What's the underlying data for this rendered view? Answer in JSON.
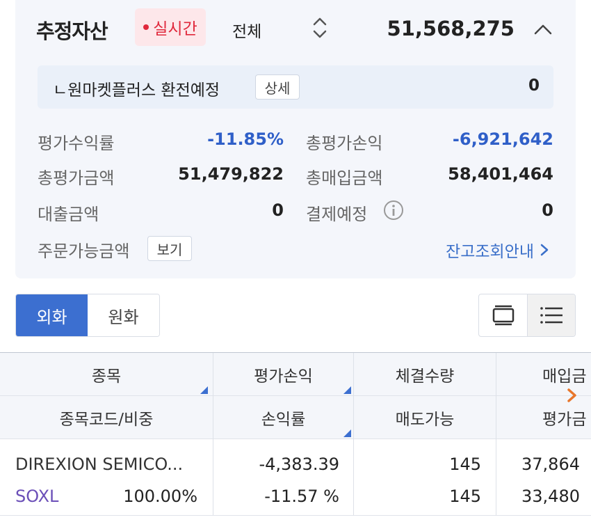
{
  "summary": {
    "title": "추정자산",
    "realtime_badge": "실시간",
    "filter_label": "전체",
    "total_value": "51,568,275",
    "exchange": {
      "label": "ㄴ원마켓플러스 환전예정",
      "detail_button": "상세",
      "value": "0"
    },
    "rows": [
      {
        "label": "평가수익률",
        "value": "-11.85%"
      },
      {
        "label": "총평가손익",
        "value": "-6,921,642"
      },
      {
        "label": "총평가금액",
        "value": "51,479,822"
      },
      {
        "label": "총매입금액",
        "value": "58,401,464"
      },
      {
        "label": "대출금액",
        "value": "0"
      },
      {
        "label": "결제예정",
        "value": "0"
      }
    ],
    "order_available_label": "주문가능금액",
    "view_button": "보기",
    "balance_guide_link": "잔고조회안내"
  },
  "currency_tabs": [
    "외화",
    "원화"
  ],
  "active_currency_tab": "외화",
  "table": {
    "headers_row1": [
      "종목",
      "평가손익",
      "체결수량",
      "매입금"
    ],
    "headers_row2": [
      "종목코드/비중",
      "손익률",
      "매도가능",
      "평가금"
    ],
    "rows": [
      {
        "name": "DIREXION SEMICO...",
        "code": "SOXL",
        "weight": "100.00%",
        "profit": "-4,383.39",
        "profit_rate": "-11.57 %",
        "qty": "145",
        "sellable": "145",
        "buy_amount": "37,864",
        "eval_amount": "33,480"
      }
    ]
  },
  "colors": {
    "accent": "#3c6fd0",
    "negative": "#2f5fc8",
    "realtime": "#e0283c",
    "scroll_arrow": "#e8762b"
  }
}
